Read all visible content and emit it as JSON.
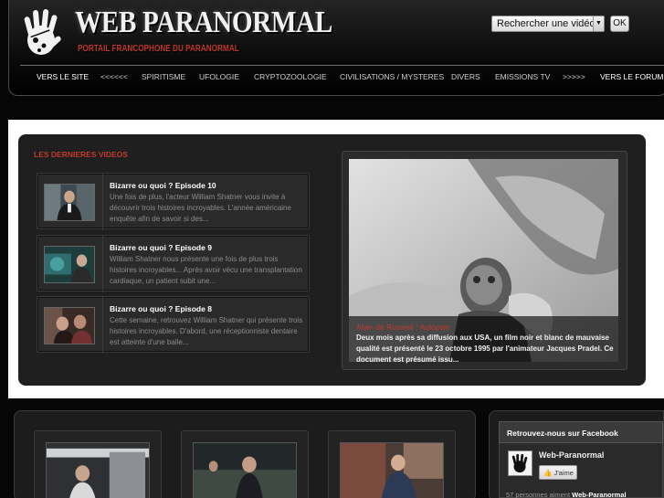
{
  "header": {
    "site_title": "WEB PARANORMAL",
    "site_subtitle": "PORTAIL FRANCOPHONE DU PARANORMAL",
    "search_select_value": "Rechercher une vidéo",
    "search_button": "OK",
    "logo_icon": "hand-print-icon"
  },
  "nav": {
    "items": [
      "VERS LE SITE",
      "<<<<<<",
      "SPIRITISME",
      "UFOLOGIE",
      "CRYPTOZOOLOGIE",
      "CIVILISATIONS / MYSTERES",
      "DIVERS",
      "EMISSIONS TV",
      ">>>>>",
      "VERS LE FORUM"
    ]
  },
  "latest": {
    "section_title": "LES DERNIERES VIDEOS",
    "videos": [
      {
        "title": "Bizarre ou quoi ? Episode 10",
        "desc": "Une fois de plus, l'acteur William Shatner vous invite à découvrir trois histoires incroyables. L'année américaine enquête afin de savoir si des..."
      },
      {
        "title": "Bizarre ou quoi ? Episode 9",
        "desc": "William Shatner nous présente une fois de plus trois histoires incroyables... Après avoir vécu une transplantation cardiaque, un patient subit une..."
      },
      {
        "title": "Bizarre ou quoi ? Episode 8",
        "desc": "Cette semaine, retrouvez William Shatner qui présente trois histoires incroyables. D'abord, une réceptionniste dentaire est atteinte d'une balle..."
      }
    ]
  },
  "featured": {
    "title": "Alien de Roswell : Autopsie",
    "desc": "Deux mois après sa diffusion aux USA, un film noir et blanc de mauvaise qualité est présenté le 23 octobre 1995 par l'animateur Jacques Pradel. Ce document est présumé issu..."
  },
  "facebook": {
    "heading": "Retrouvez-nous sur Facebook",
    "page_name": "Web-Paranormal",
    "like_label": "J'aime",
    "count_text": "57 personnes aiment",
    "count_page": "Web-Paranormal"
  },
  "colors": {
    "accent": "#c0392b",
    "background": "#060606",
    "panel": "#1f1f1f"
  }
}
